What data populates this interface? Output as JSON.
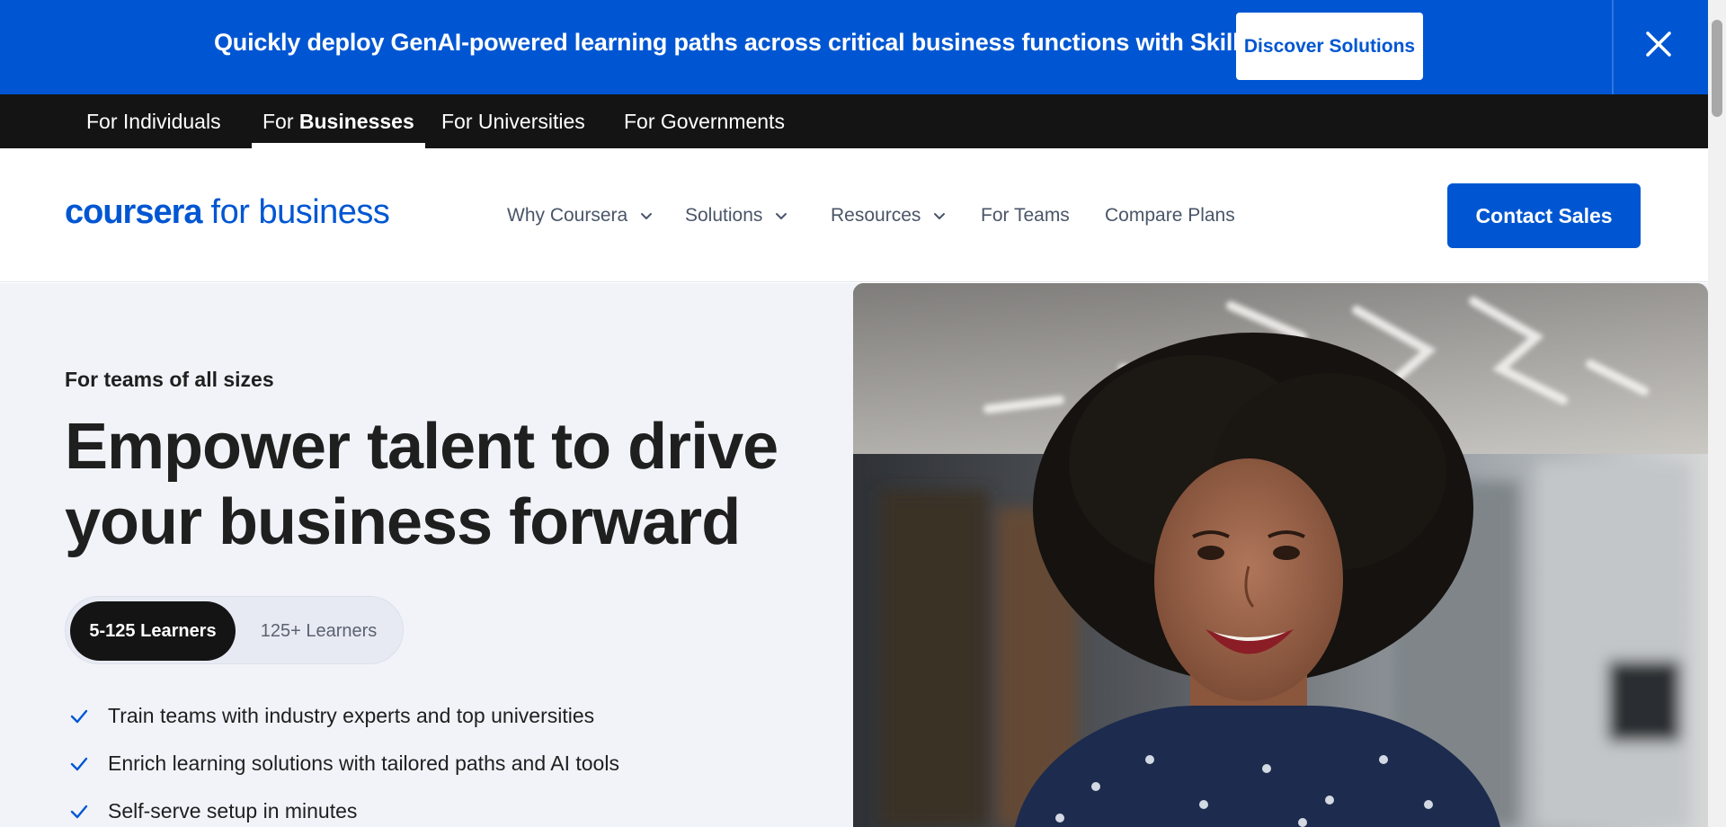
{
  "promo": {
    "message": "Quickly deploy GenAI-powered learning paths across critical business functions with Skills Tracks",
    "button_label": "Discover Solutions",
    "close_icon": "close-icon",
    "background_color": "#0056d2"
  },
  "audience_nav": {
    "items": [
      {
        "prefix": "For",
        "label": "Individuals"
      },
      {
        "prefix": "For",
        "label": "Businesses",
        "active": true
      },
      {
        "prefix": "For",
        "label": "Universities"
      },
      {
        "prefix": "For",
        "label": "Governments"
      }
    ]
  },
  "header": {
    "logo_brand": "coursera",
    "logo_sub": "for business",
    "nav": [
      {
        "label": "Why Coursera",
        "has_dropdown": true
      },
      {
        "label": "Solutions",
        "has_dropdown": true
      },
      {
        "label": "Resources",
        "has_dropdown": true
      },
      {
        "label": "For Teams",
        "has_dropdown": false
      },
      {
        "label": "Compare Plans",
        "has_dropdown": false
      }
    ],
    "cta_label": "Contact Sales"
  },
  "hero": {
    "eyebrow": "For teams of all sizes",
    "headline": "Empower talent to drive your business forward",
    "toggle": {
      "options": [
        "5-125 Learners",
        "125+ Learners"
      ],
      "selected": "5-125 Learners"
    },
    "benefits": [
      "Train teams with industry experts and top universities",
      "Enrich learning solutions with tailored paths and AI tools",
      "Self-serve setup in minutes"
    ],
    "image_icon": "smiling-woman-photo"
  },
  "colors": {
    "brand_blue": "#0056d2",
    "dark": "#141414",
    "hero_bg": "#f1f3f8"
  }
}
